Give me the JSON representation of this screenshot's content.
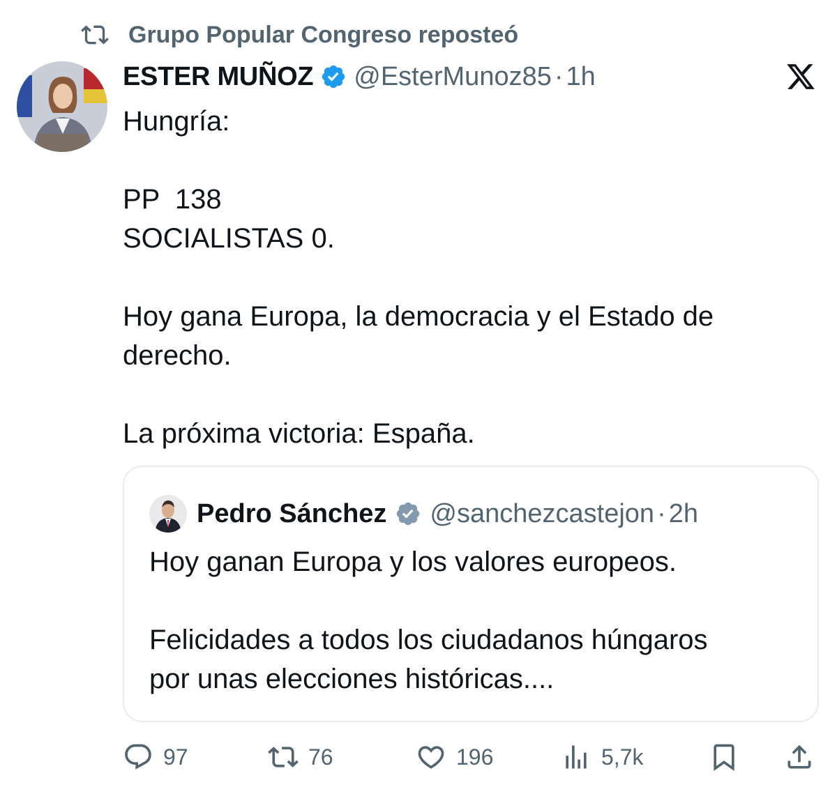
{
  "repost": {
    "label": "Grupo Popular Congreso reposteó",
    "icon": "repost-icon"
  },
  "tweet": {
    "author": "ESTER MUÑOZ",
    "handle": "@EsterMunoz85",
    "separator": "·",
    "time": "1h",
    "lines": [
      "Hungría:",
      "",
      "PP  138",
      "SOCIALISTAS 0.",
      "",
      "Hoy gana Europa, la democracia y el Estado de",
      "derecho.",
      "",
      "La próxima victoria: España."
    ]
  },
  "quote": {
    "author": "Pedro Sánchez",
    "handle": "@sanchezcastejon",
    "separator": "·",
    "time": "2h",
    "lines": [
      "Hoy ganan Europa y los valores europeos.",
      "",
      "Felicidades a todos los ciudadanos húngaros",
      "por unas elecciones históricas...."
    ]
  },
  "actions": {
    "replies": "97",
    "reposts": "76",
    "likes": "196",
    "views": "5,7k"
  },
  "colors": {
    "text": "#0f1419",
    "muted": "#536471",
    "verified_blue": "#1d9bf0",
    "verified_gray": "#829aab",
    "border": "#e6ecf0"
  }
}
